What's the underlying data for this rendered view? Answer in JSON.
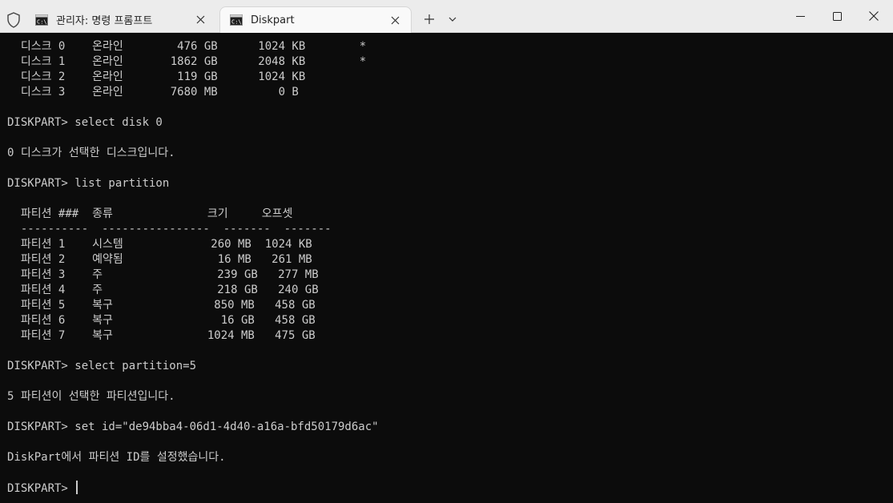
{
  "titlebar": {
    "tabs": [
      {
        "label": "관리자: 명령 프롬프트",
        "active": false,
        "icon": "cmd-icon"
      },
      {
        "label": "Diskpart",
        "active": true,
        "icon": "cmd-icon"
      }
    ],
    "new_tab_icon": "plus-icon",
    "dropdown_icon": "chevron-down-icon",
    "window_controls": [
      "minimize-icon",
      "maximize-icon",
      "close-icon"
    ]
  },
  "colors": {
    "terminal_bg": "#0c0c0c",
    "terminal_fg": "#cccccc",
    "titlebar_bg": "#ececec"
  },
  "terminal": {
    "lines": [
      "  디스크 0    온라인        476 GB      1024 KB        *",
      "  디스크 1    온라인       1862 GB      2048 KB        *",
      "  디스크 2    온라인        119 GB      1024 KB",
      "  디스크 3    온라인       7680 MB         0 B",
      "",
      "DISKPART> select disk 0",
      "",
      "0 디스크가 선택한 디스크입니다.",
      "",
      "DISKPART> list partition",
      "",
      "  파티션 ###  종류              크기     오프셋",
      "  ----------  ----------------  -------  -------",
      "  파티션 1    시스템             260 MB  1024 KB",
      "  파티션 2    예약됨              16 MB   261 MB",
      "  파티션 3    주                 239 GB   277 MB",
      "  파티션 4    주                 218 GB   240 GB",
      "  파티션 5    복구               850 MB   458 GB",
      "  파티션 6    복구                16 GB   458 GB",
      "  파티션 7    복구              1024 MB   475 GB",
      "",
      "DISKPART> select partition=5",
      "",
      "5 파티션이 선택한 파티션입니다.",
      "",
      "DISKPART> set id=\"de94bba4-06d1-4d40-a16a-bfd50179d6ac\"",
      "",
      "DiskPart에서 파티션 ID를 설정했습니다.",
      "",
      "DISKPART> "
    ]
  }
}
